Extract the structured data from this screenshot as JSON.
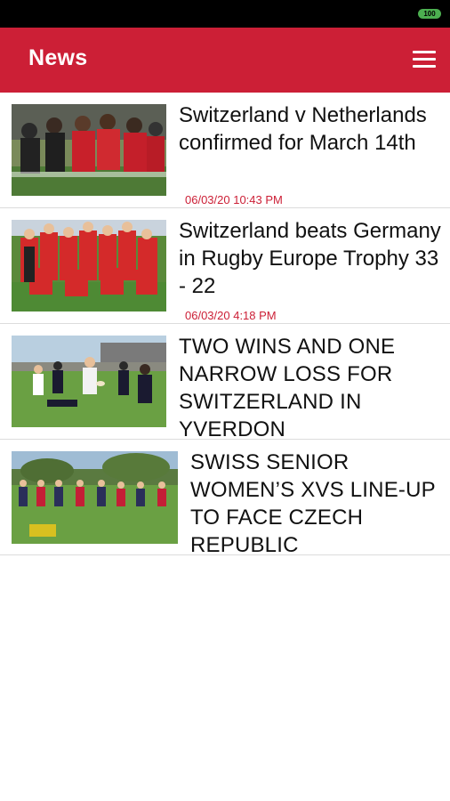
{
  "status_bar": {
    "battery_label": "100"
  },
  "app_bar": {
    "title": "News",
    "menu_icon": "hamburger-menu-icon"
  },
  "colors": {
    "brand_red": "#cc1f36",
    "date_red": "#cc1f36",
    "divider": "#dcdcdc"
  },
  "news": [
    {
      "headline": "Switzerland v Netherlands confirmed for March 14th",
      "date": "06/03/20 10:43 PM"
    },
    {
      "headline": "Switzerland beats Germany in Rugby Europe Trophy 33 - 22",
      "date": "06/03/20 4:18 PM"
    },
    {
      "headline": "TWO WINS AND ONE NARROW LOSS FOR SWITZERLAND IN YVERDON",
      "date": ""
    },
    {
      "headline": "SWISS SENIOR WOMEN’S XVS LINE-UP TO FACE CZECH REPUBLIC",
      "date": ""
    }
  ]
}
